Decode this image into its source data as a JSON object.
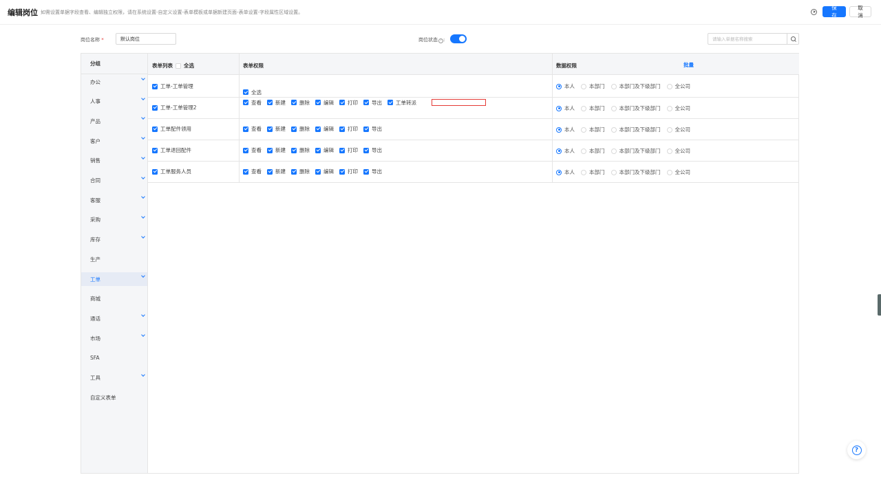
{
  "header": {
    "title": "编辑岗位",
    "hint": "如需设置单据字段查看、编辑独立权限，请在系统设置-自定义设置-表单模板或单据新建页面-表单设置-字段属性区域设置。",
    "save_label": "保存",
    "cancel_label": "取消"
  },
  "filters": {
    "position_name_label": "岗位名称",
    "position_name_value": "默认岗位",
    "status_label": "岗位状态",
    "status_on": true,
    "search_placeholder": "请输入单据名称搜索"
  },
  "sidebar": {
    "heading": "分组",
    "items": [
      {
        "label": "办公",
        "expandable": true
      },
      {
        "label": "人事",
        "expandable": true
      },
      {
        "label": "产品",
        "expandable": true
      },
      {
        "label": "客户",
        "expandable": true
      },
      {
        "label": "销售",
        "expandable": true
      },
      {
        "label": "合同",
        "expandable": true
      },
      {
        "label": "客服",
        "expandable": true
      },
      {
        "label": "采购",
        "expandable": true
      },
      {
        "label": "库存",
        "expandable": true
      },
      {
        "label": "生产",
        "expandable": false
      },
      {
        "label": "工单",
        "expandable": true,
        "active": true
      },
      {
        "label": "商城",
        "expandable": false
      },
      {
        "label": "通话",
        "expandable": true
      },
      {
        "label": "市场",
        "expandable": true
      },
      {
        "label": "SFA",
        "expandable": false
      },
      {
        "label": "工具",
        "expandable": true
      },
      {
        "label": "自定义表单",
        "expandable": false
      }
    ]
  },
  "table": {
    "col_forms": "表单列表",
    "select_all_label": "全选",
    "col_permissions": "表单权限",
    "col_data_permissions": "数据权限",
    "batch_label": "批量",
    "perm_select_all": "全选",
    "rows": [
      {
        "form": "工单-工单管理",
        "perms": [],
        "data_scope": "本人"
      },
      {
        "form": "工单-工单管理2",
        "perms": [
          "查看",
          "新建",
          "删除",
          "编辑",
          "打印",
          "导出",
          "工单转派"
        ],
        "data_scope": "本人"
      },
      {
        "form": "工单配件领用",
        "perms": [
          "查看",
          "新建",
          "删除",
          "编辑",
          "打印",
          "导出"
        ],
        "data_scope": "本人"
      },
      {
        "form": "工单退回配件",
        "perms": [
          "查看",
          "新建",
          "删除",
          "编辑",
          "打印",
          "导出"
        ],
        "data_scope": "本人"
      },
      {
        "form": "工单服务人员",
        "perms": [
          "查看",
          "新建",
          "删除",
          "编辑",
          "打印",
          "导出"
        ],
        "data_scope": "本人"
      }
    ],
    "data_scope_options": [
      "本人",
      "本部门",
      "本部门及下级部门",
      "全公司"
    ]
  }
}
